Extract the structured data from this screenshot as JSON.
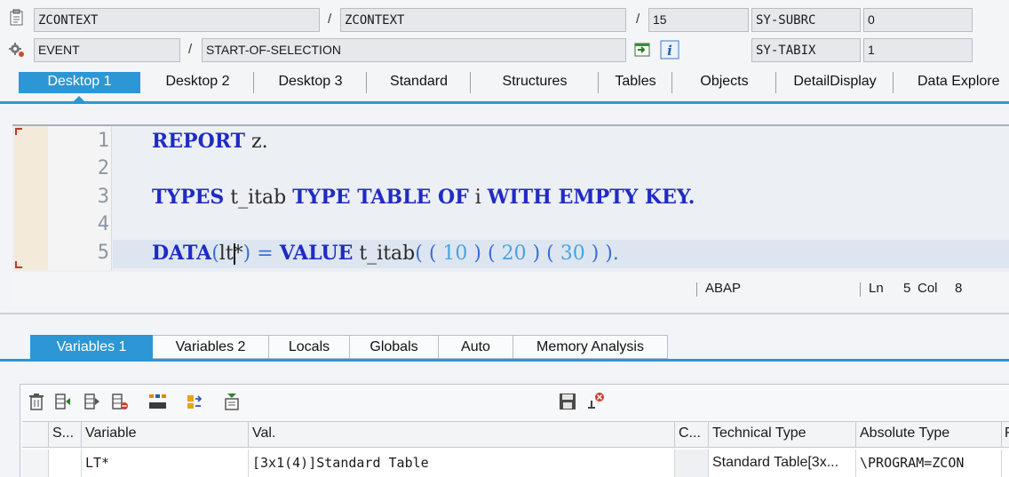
{
  "header": {
    "program_1": "ZCONTEXT",
    "program_2": "ZCONTEXT",
    "line": "15",
    "event_type": "EVENT",
    "event_name": "START-OF-SELECTION",
    "subrc_label": "SY-SUBRC",
    "subrc_value": "0",
    "tabix_label": "SY-TABIX",
    "tabix_value": "1",
    "sep": "/"
  },
  "top_tabs": [
    "Desktop 1",
    "Desktop 2",
    "Desktop 3",
    "Standard",
    "Structures",
    "Tables",
    "Objects",
    "DetailDisplay",
    "Data Explore"
  ],
  "editor": {
    "line_numbers": [
      "1",
      "2",
      "3",
      "4",
      "5"
    ],
    "line1": {
      "kw": "REPORT",
      "rest": " z."
    },
    "line3": {
      "kw1": "TYPES",
      "id1": " t_itab ",
      "kw2": "TYPE TABLE OF",
      "id2": " i ",
      "kw3": "WITH EMPTY KEY",
      "end": "."
    },
    "line5": {
      "kw1": "DATA",
      "p1": "(",
      "id1": "lt",
      "cursor_char": "*",
      "p2": ")",
      "op1": " = ",
      "kw2": "VALUE",
      "id2": " t_itab",
      "p3": "( ( ",
      "n1": "10",
      "p4": " ) ( ",
      "n2": "20",
      "p5": " ) ( ",
      "n3": "30",
      "p6": " ) )",
      "end": "."
    },
    "status_lang": "ABAP",
    "status_ln_label": "Ln",
    "status_ln": "5",
    "status_col_label": "Col",
    "status_col": "8"
  },
  "bottom_tabs": [
    "Variables 1",
    "Variables 2",
    "Locals",
    "Globals",
    "Auto",
    "Memory Analysis"
  ],
  "table": {
    "columns": [
      "S...",
      "Variable",
      "Val.",
      "C...",
      "Technical Type",
      "Absolute Type",
      "F"
    ],
    "rows": [
      {
        "variable": "LT*",
        "value": "[3x1(4)]Standard Table",
        "technical_type": "Standard Table[3x...",
        "absolute_type": "\\PROGRAM=ZCON"
      }
    ]
  },
  "colors": {
    "accent": "#2c97d4",
    "keyword": "#1f2bc4",
    "number": "#4aa3e0"
  }
}
